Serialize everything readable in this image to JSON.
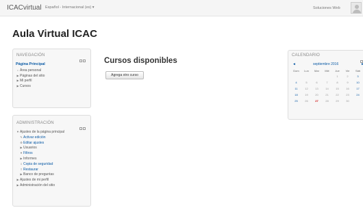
{
  "navbar": {
    "brand": "ICACvirtual",
    "language": "Español - Internacional (es) ▾",
    "user_name": "Soluciones Web"
  },
  "page": {
    "title": "Aula Virtual ICAC"
  },
  "navigation": {
    "title": "NAVEGACIÓN",
    "items": [
      {
        "label": "Página Principal",
        "icon": "none"
      },
      {
        "label": "Área personal",
        "icon": "bullet-icon"
      },
      {
        "label": "Páginas del sitio",
        "icon": "caret-right-icon"
      },
      {
        "label": "Mi perfil",
        "icon": "caret-right-icon"
      },
      {
        "label": "Cursos",
        "icon": "caret-right-icon"
      }
    ]
  },
  "administration": {
    "title": "ADMINISTRACIÓN",
    "items": [
      {
        "label": "Ajustes de la página principal",
        "icon": "caret-down-icon"
      },
      {
        "label": "Activar edición",
        "icon": "pencil-icon"
      },
      {
        "label": "Editar ajustes",
        "icon": "gear-icon"
      },
      {
        "label": "Usuarios",
        "icon": "caret-right-icon"
      },
      {
        "label": "Filtros",
        "icon": "filter-icon"
      },
      {
        "label": "Informes",
        "icon": "caret-right-icon"
      },
      {
        "label": "Copia de seguridad",
        "icon": "backup-icon"
      },
      {
        "label": "Restaurar",
        "icon": "restore-icon"
      },
      {
        "label": "Banco de preguntas",
        "icon": "caret-right-icon"
      },
      {
        "label": "Ajustes de mi perfil",
        "icon": "caret-right-icon"
      },
      {
        "label": "Administración del sitio",
        "icon": "caret-right-icon"
      }
    ]
  },
  "main": {
    "section_title": "Cursos disponibles",
    "add_course_button": "Agrega otro curso"
  },
  "calendar": {
    "title": "CALENDARIO",
    "month": "septiembre 2016",
    "prev": "◄",
    "next": "►",
    "weekdays": [
      "Dom",
      "Lun",
      "Mar",
      "Mié",
      "Jue",
      "Vie",
      "Sáb"
    ],
    "weeks": [
      [
        "",
        "",
        "",
        "",
        "1",
        "2",
        "3"
      ],
      [
        "4",
        "5",
        "6",
        "7",
        "8",
        "9",
        "10"
      ],
      [
        "11",
        "12",
        "13",
        "14",
        "15",
        "16",
        "17"
      ],
      [
        "18",
        "19",
        "20",
        "21",
        "22",
        "23",
        "24"
      ],
      [
        "25",
        "26",
        "27",
        "28",
        "29",
        "30",
        ""
      ]
    ],
    "today": "27"
  }
}
